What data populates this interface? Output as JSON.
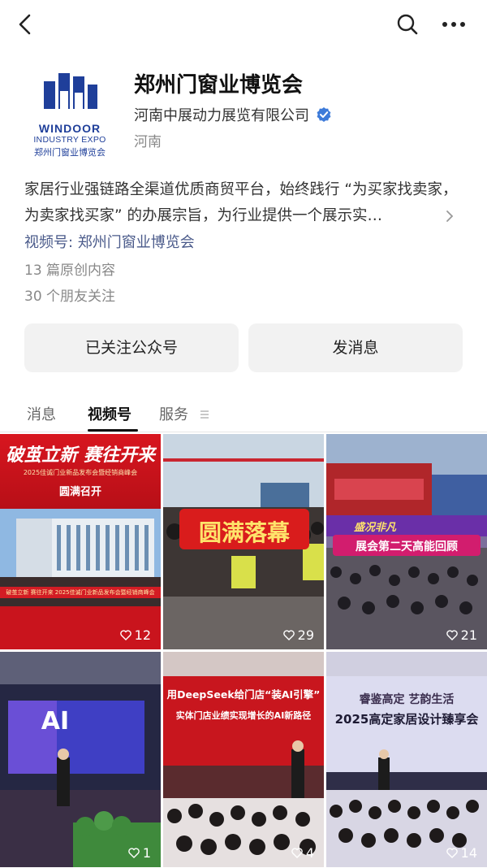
{
  "account": {
    "name": "郑州门窗业博览会",
    "organization": "河南中展动力展览有限公司",
    "region": "河南",
    "logo": {
      "line1": "WINDOOR",
      "line2": "INDUSTRY EXPO",
      "line3": "郑州门窗业博览会"
    }
  },
  "description": "家居行业强链路全渠道优质商贸平台，始终践行 “为买家找卖家，为卖家找买家” 的办展宗旨，为行业提供一个展示实…",
  "channel_link": "视频号: 郑州门窗业博览会",
  "stats": {
    "original": "13 篇原创内容",
    "friends": "30 个朋友关注"
  },
  "buttons": {
    "follow": "已关注公众号",
    "message": "发消息"
  },
  "tabs": [
    "消息",
    "视频号",
    "服务"
  ],
  "videos": [
    {
      "likes": "12",
      "headline": "破茧立新 赛往开来",
      "subline": "2025佳诚门业新品发布会暨经销商峰会",
      "badge": "圆满召开",
      "banner": "破茧立新 赛往开来 2025佳诚门业新品发布会暨经销商峰会"
    },
    {
      "likes": "29",
      "badge": "圆满落幕"
    },
    {
      "likes": "21",
      "headline": "盛况非凡",
      "badge": "展会第二天高能回顾"
    },
    {
      "likes": "1",
      "headline": "AI"
    },
    {
      "likes": "4",
      "headline": "用DeepSeek给门店“装AI引擎”",
      "subline": "实体门店业绩实现增长的AI新路径"
    },
    {
      "likes": "14",
      "headline": "睿鉴高定 艺韵生活",
      "subline": "2025高定家居设计臻享会"
    }
  ],
  "colors": {
    "verify": "#3d7bd9",
    "link": "#4a5a8a",
    "button_bg": "#f2f2f2",
    "logo_blue": "#1f3f9a"
  }
}
